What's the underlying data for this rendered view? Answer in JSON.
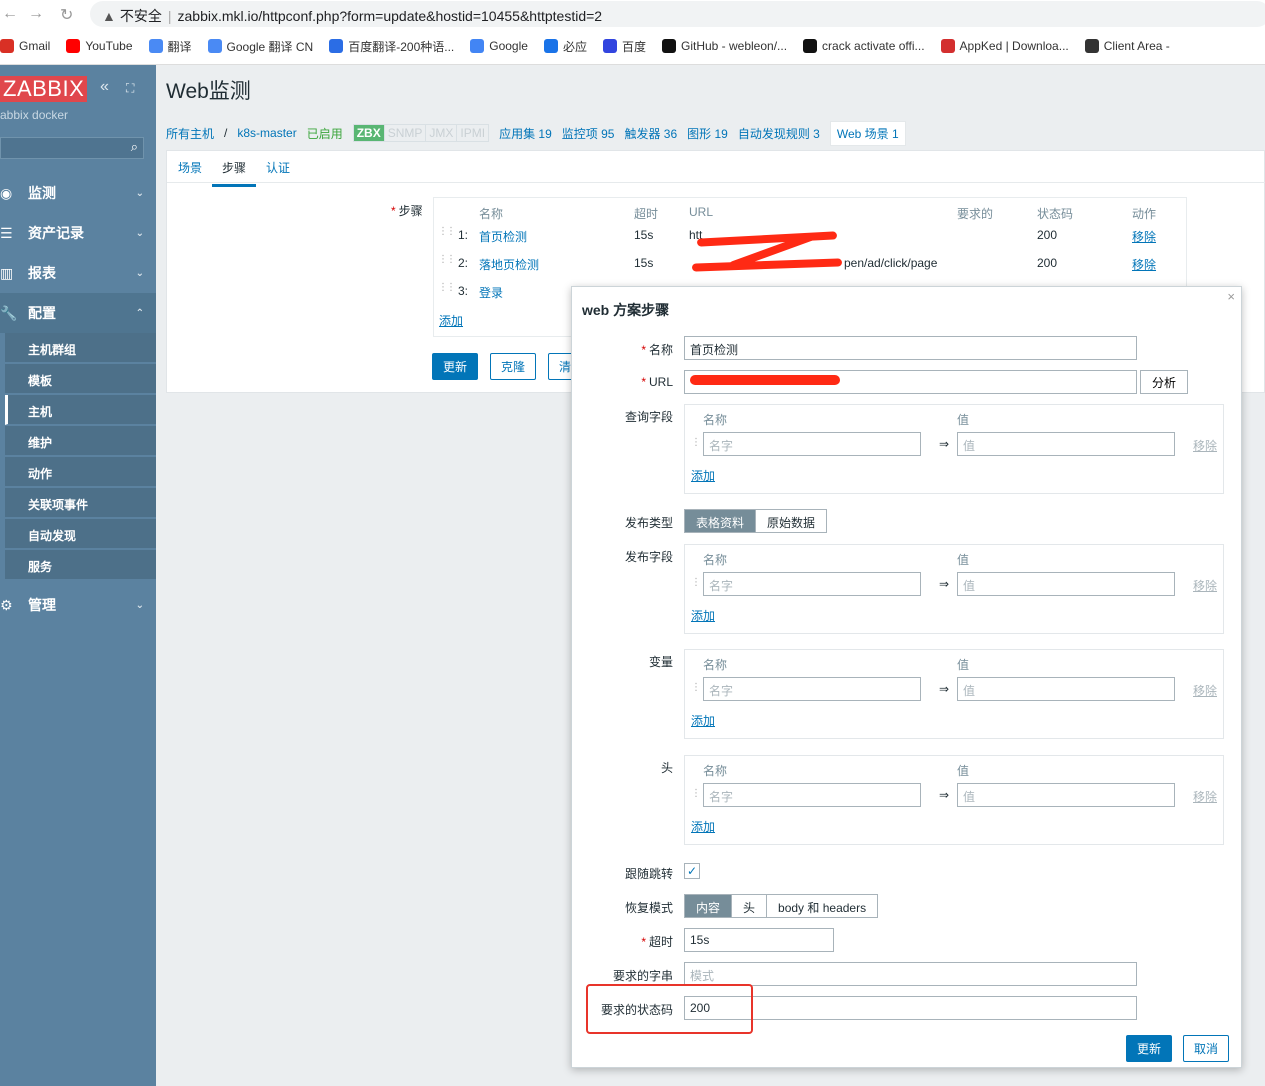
{
  "browser": {
    "security": "不安全",
    "url": "zabbix.mkl.io/httpconf.php?form=update&hostid=10455&httptestid=2",
    "bookmarks": [
      {
        "label": "Gmail",
        "icon": "gmail-icon",
        "color": "#d93025"
      },
      {
        "label": "YouTube",
        "icon": "youtube-icon",
        "color": "#ff0000"
      },
      {
        "label": "翻译",
        "icon": "google-translate-icon",
        "color": "#4a8af4"
      },
      {
        "label": "Google 翻译 CN",
        "icon": "google-translate-icon",
        "color": "#4a8af4"
      },
      {
        "label": "百度翻译-200种语...",
        "icon": "baidu-translate-icon",
        "color": "#2b6de5"
      },
      {
        "label": "Google",
        "icon": "google-icon",
        "color": "#4285f4"
      },
      {
        "label": "必应",
        "icon": "bing-icon",
        "color": "#1a73e8"
      },
      {
        "label": "百度",
        "icon": "baidu-icon",
        "color": "#3245df"
      },
      {
        "label": "GitHub - webleon/...",
        "icon": "github-icon",
        "color": "#111"
      },
      {
        "label": "crack activate offi...",
        "icon": "github-icon",
        "color": "#111"
      },
      {
        "label": "AppKed | Downloa...",
        "icon": "appked-icon",
        "color": "#d32f2f"
      },
      {
        "label": "Client Area -",
        "icon": "globe-icon",
        "color": "#333"
      }
    ]
  },
  "sidebar": {
    "logo": "ZABBIX",
    "server": "abbix docker",
    "menus": [
      {
        "label": "监测",
        "icon": "eye-icon"
      },
      {
        "label": "资产记录",
        "icon": "list-icon"
      },
      {
        "label": "报表",
        "icon": "chart-icon"
      },
      {
        "label": "配置",
        "icon": "wrench-icon"
      },
      {
        "label": "管理",
        "icon": "gear-icon"
      }
    ],
    "submenu": [
      "主机群组",
      "模板",
      "主机",
      "维护",
      "动作",
      "关联项事件",
      "自动发现",
      "服务"
    ],
    "active": "主机"
  },
  "page": {
    "title": "Web监测"
  },
  "breadcrumb": {
    "all_hosts": "所有主机",
    "host": "k8s-master",
    "status": "已启用",
    "avail": [
      "ZBX",
      "SNMP",
      "JMX",
      "IPMI"
    ],
    "links": [
      "应用集 19",
      "监控项 95",
      "触发器 36",
      "图形 19",
      "自动发现规则 3"
    ],
    "current": "Web 场景 1"
  },
  "tabs": [
    "场景",
    "步骤",
    "认证"
  ],
  "steps": {
    "label": "步骤",
    "headers": [
      "名称",
      "超时",
      "URL",
      "要求的",
      "状态码",
      "动作"
    ],
    "rows": [
      {
        "num": "1:",
        "name": "首页检测",
        "timeout": "15s",
        "url": "htt",
        "code": "200",
        "action": "移除"
      },
      {
        "num": "2:",
        "name": "落地页检测",
        "timeout": "15s",
        "url": "pen/ad/click/page",
        "code": "200",
        "action": "移除"
      },
      {
        "num": "3:",
        "name": "登录"
      }
    ],
    "add": "添加",
    "buttons": [
      "更新",
      "克隆",
      "清"
    ]
  },
  "modal": {
    "title": "web 方案步骤",
    "name_label": "名称",
    "name": "首页检测",
    "url_label": "URL",
    "parse": "分析",
    "query_label": "查询字段",
    "post_type_label": "发布类型",
    "post_types": [
      "表格资料",
      "原始数据"
    ],
    "post_fields_label": "发布字段",
    "variables_label": "变量",
    "headers_label": "头",
    "col_name": "名称",
    "col_value": "值",
    "name_ph": "名字",
    "value_ph": "值",
    "remove": "移除",
    "add": "添加",
    "follow_label": "跟随跳转",
    "follow": true,
    "retrieve_label": "恢复模式",
    "retrieve_modes": [
      "内容",
      "头",
      "body 和 headers"
    ],
    "timeout_label": "超时",
    "timeout": "15s",
    "req_string_label": "要求的字串",
    "req_string_ph": "模式",
    "req_code_label": "要求的状态码",
    "req_code": "200",
    "update": "更新",
    "cancel": "取消"
  }
}
